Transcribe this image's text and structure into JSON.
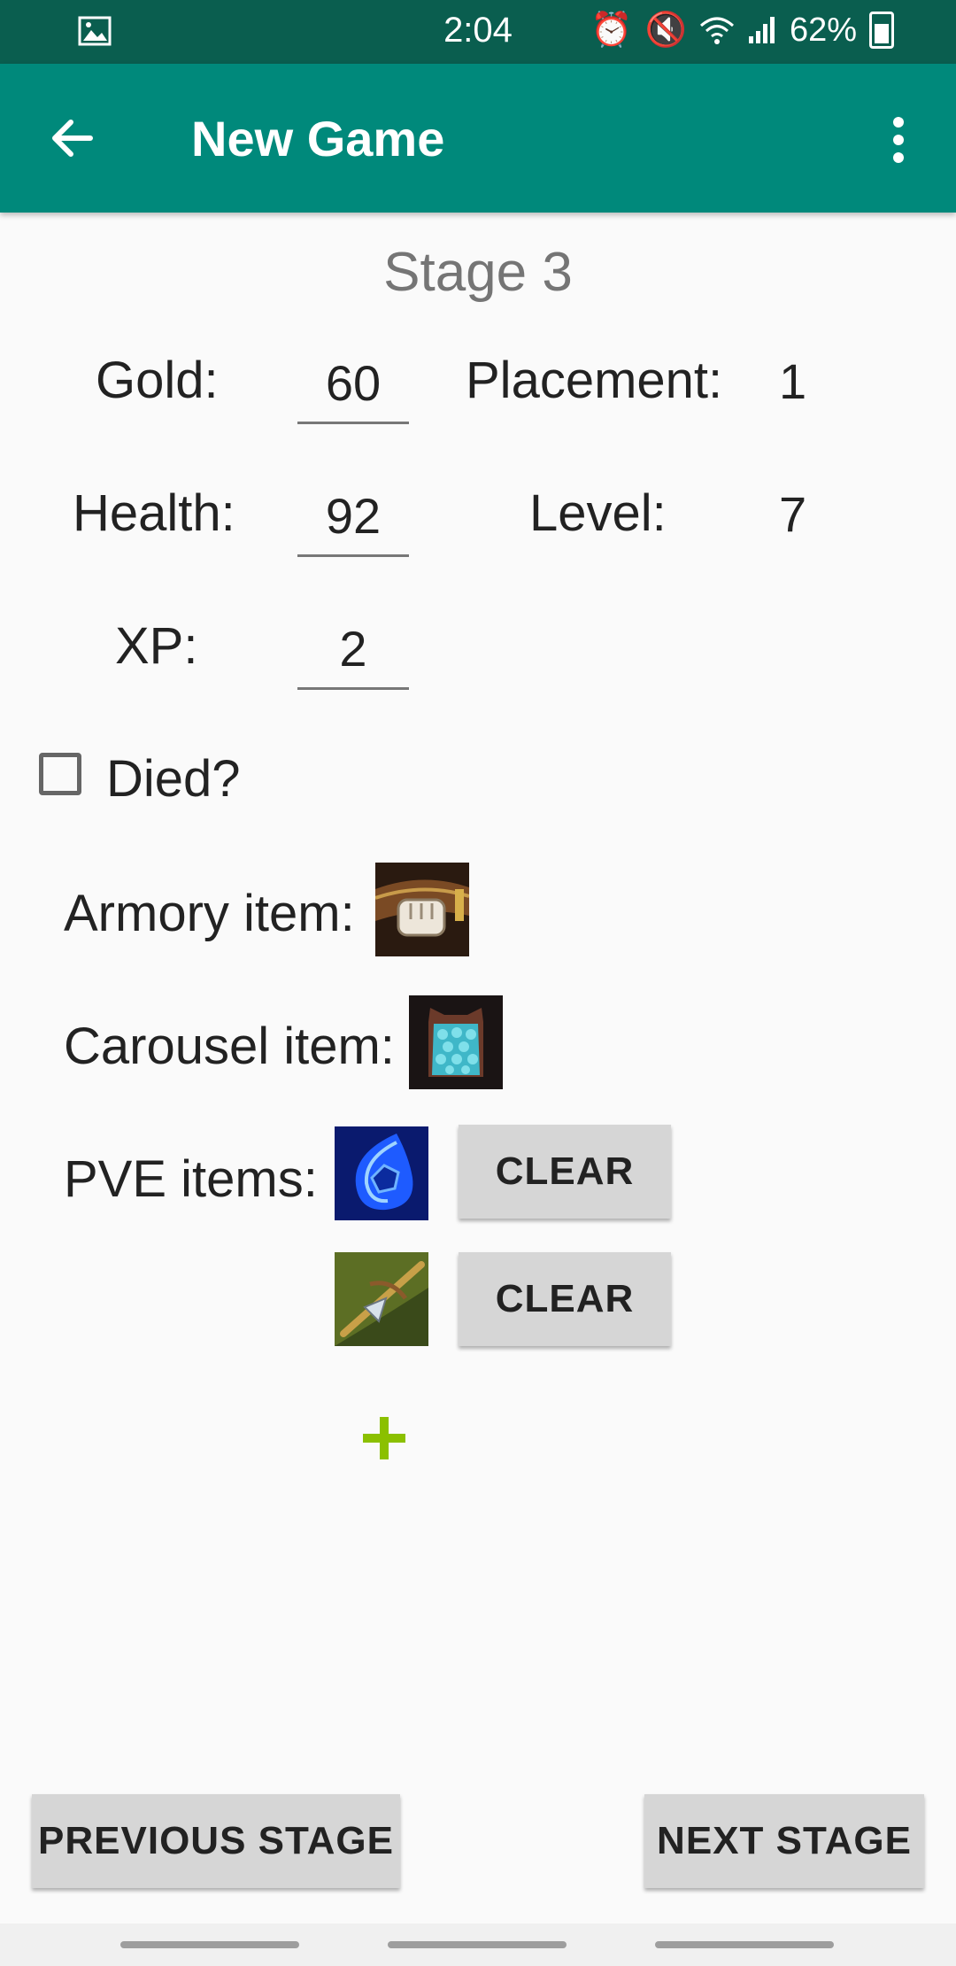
{
  "status_bar": {
    "time": "2:04",
    "battery": "62%"
  },
  "app_bar": {
    "title": "New Game",
    "back_icon": "arrow-back-icon",
    "menu_icon": "more-vert-icon"
  },
  "stage": {
    "title": "Stage 3"
  },
  "stats": {
    "gold_label": "Gold:",
    "gold_value": "60",
    "placement_label": "Placement:",
    "placement_value": "1",
    "health_label": "Health:",
    "health_value": "92",
    "level_label": "Level:",
    "level_value": "7",
    "xp_label": "XP:",
    "xp_value": "2"
  },
  "died": {
    "label": "Died?",
    "checked": false
  },
  "items": {
    "armory_label": "Armory item:",
    "carousel_label": "Carousel item:",
    "pve_label": "PVE items:",
    "clear_label": "CLEAR",
    "add_icon": "plus-icon"
  },
  "footer": {
    "previous_label": "PREVIOUS STAGE",
    "next_label": "NEXT STAGE"
  },
  "colors": {
    "appbar": "#00897B",
    "statusbar": "#0A5E4F",
    "accent_plus": "#8BC000"
  }
}
